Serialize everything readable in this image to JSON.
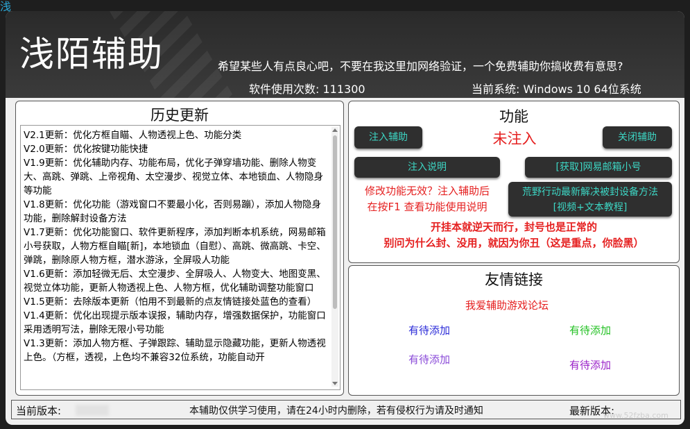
{
  "corner_title": "浅",
  "header": {
    "app_title": "浅陌辅助",
    "slogan": "希望某些人有点良心吧，不要在我这里加网络验证，一个免费辅助你搞收费有意思?",
    "usage": "软件使用次数:  111300",
    "system": "当前系统:  Windows 10   64位系统"
  },
  "history": {
    "title": "历史更新",
    "entries": [
      "V2.1更新：优化方框自瞄、人物透视上色、功能分类",
      "V2.0更新：优化按键功能快捷",
      "V1.9更新：优化辅助内存、功能布局，优化子弹穿墙功能、删除人物变大、高跳、弹跳、上帝视角、太空漫步、视觉立体、本地锁血、人物隐身等功能",
      "V1.8更新：优化功能（游戏窗口不要最小化，否则易蹦），添加人物隐身功能，删除解封设备方法",
      "V1.7更新：优化功能窗口、软件更新程序，添加判断本机系统，网易邮箱小号获取，人物方框自瞄[新]，本地锁血（自慰）、高跳、微高跳、卡空、弹跳，删除原人物方框，潜水游泳，全屏吸人功能",
      "V1.6更新：添加轻微无后、太空漫步、全屏吸人、人物变大、地图变黑、视觉立体功能，更新人物透视上色、人物方框，优化辅助调整功能窗口",
      "V1.5更新：去除版本更新（怕用不到最新的点友情链接处蓝色的查看）",
      "V1.4更新：优化出现提示版本误报，辅助内存，增强数据保护，功能窗口采用透明写法，删除无限小号功能",
      "V1.3更新：添加人物方框、子弹跟踪、辅助显示隐藏功能，更新人物透视上色。（方框，透视，上色均不兼容32位系统，功能自动开"
    ]
  },
  "features": {
    "title": "功能",
    "inject_button": "注入辅助",
    "status": "未注入",
    "close_button": "关闭辅助",
    "guide_button": "注入说明",
    "mail_button": "[获取]网易邮箱小号",
    "hint_line1": "修改功能无效？注入辅助后",
    "hint_line2": "在按F1 查看功能使用说明",
    "tutorial_line1": "荒野行动最新解决被封设备方法",
    "tutorial_line2": "[视频+文本教程]",
    "warning_line1": "开挂本就逆天而行，封号也是正常的",
    "warning_line2": "别问为什么封、没用，就因为你丑（这是重点，你脸黑）"
  },
  "links": {
    "title": "友情链接",
    "forum": "我爱辅助游戏论坛",
    "pending_1": "有待添加",
    "pending_2": "有待添加",
    "pending_3": "有待添加",
    "pending_4": "有待添加"
  },
  "footer": {
    "current_version_label": "当前版本:",
    "notice": "本辅助仅供学习使用，请在24小时内删除，若有侵权行为请及时通知",
    "latest_version_label": "最新版本:"
  },
  "watermark": "www.52fzba.com"
}
